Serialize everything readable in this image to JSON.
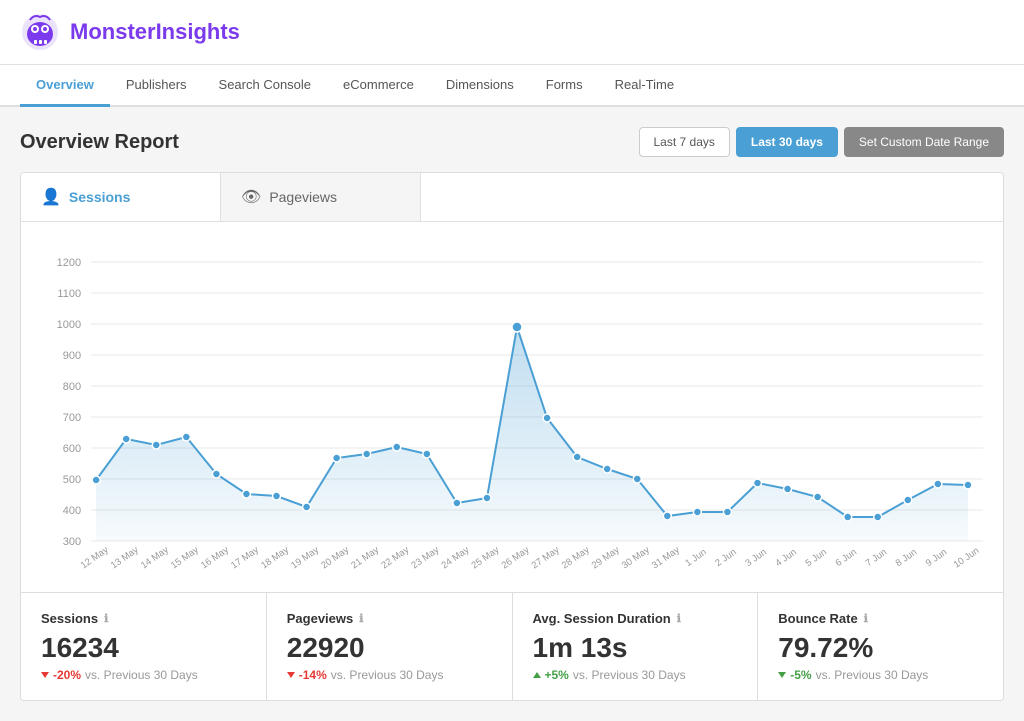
{
  "header": {
    "logo_text_normal": "Monster",
    "logo_text_accent": "Insights"
  },
  "nav": {
    "items": [
      {
        "label": "Overview",
        "active": true
      },
      {
        "label": "Publishers",
        "active": false
      },
      {
        "label": "Search Console",
        "active": false
      },
      {
        "label": "eCommerce",
        "active": false
      },
      {
        "label": "Dimensions",
        "active": false
      },
      {
        "label": "Forms",
        "active": false
      },
      {
        "label": "Real-Time",
        "active": false
      }
    ]
  },
  "overview": {
    "title": "Overview Report",
    "date_buttons": {
      "last7": "Last 7 days",
      "last30": "Last 30 days",
      "custom": "Set Custom Date Range"
    }
  },
  "chart": {
    "tab_sessions": "Sessions",
    "tab_pageviews": "Pageviews",
    "y_labels": [
      "1200",
      "1100",
      "1000",
      "900",
      "800",
      "700",
      "600",
      "500",
      "400",
      "300"
    ],
    "x_labels": [
      "12 May",
      "13 May",
      "14 May",
      "15 May",
      "16 May",
      "17 May",
      "18 May",
      "19 May",
      "20 May",
      "21 May",
      "22 May",
      "23 May",
      "24 May",
      "25 May",
      "26 May",
      "27 May",
      "28 May",
      "29 May",
      "30 May",
      "31 May",
      "1 Jun",
      "2 Jun",
      "3 Jun",
      "4 Jun",
      "5 Jun",
      "6 Jun",
      "7 Jun",
      "8 Jun",
      "9 Jun",
      "10 Jun"
    ]
  },
  "stats": [
    {
      "label": "Sessions",
      "value": "16234",
      "change": "-20%",
      "change_type": "down",
      "vs_label": "vs. Previous 30 Days"
    },
    {
      "label": "Pageviews",
      "value": "22920",
      "change": "-14%",
      "change_type": "down",
      "vs_label": "vs. Previous 30 Days"
    },
    {
      "label": "Avg. Session Duration",
      "value": "1m 13s",
      "change": "+5%",
      "change_type": "up",
      "vs_label": "vs. Previous 30 Days"
    },
    {
      "label": "Bounce Rate",
      "value": "79.72%",
      "change": "-5%",
      "change_type": "up",
      "vs_label": "vs. Previous 30 Days"
    }
  ]
}
